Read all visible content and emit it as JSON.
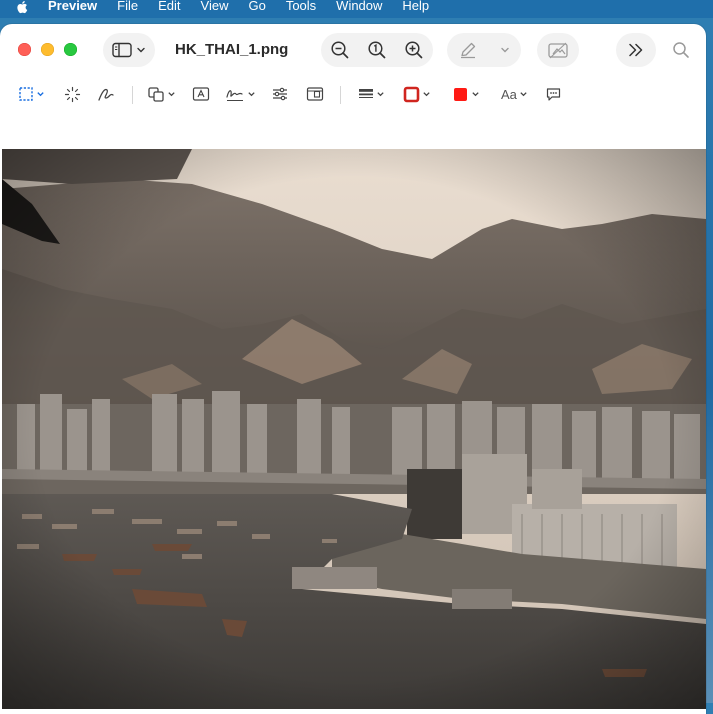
{
  "menubar": {
    "app_name": "Preview",
    "items": [
      "File",
      "Edit",
      "View",
      "Go",
      "Tools",
      "Window",
      "Help"
    ]
  },
  "window": {
    "document_title": "HK_THAI_1.png"
  },
  "toolbar": {
    "text_style_label": "Aa"
  },
  "icons": {
    "apple": "apple-icon",
    "sidebar": "sidebar-icon",
    "zoom_out": "zoom-out-icon",
    "actual_size": "actual-size-icon",
    "zoom_in": "zoom-in-icon",
    "markup": "pen-icon",
    "rotate": "rotate-icon",
    "more": "chevron-double-right-icon",
    "search": "search-icon"
  },
  "colors": {
    "border_color": "#d0251f",
    "fill_color": "#ff1a14",
    "menubar": "#1e6eaa"
  },
  "image": {
    "description_visible": "",
    "file": "HK_THAI_1.png"
  }
}
